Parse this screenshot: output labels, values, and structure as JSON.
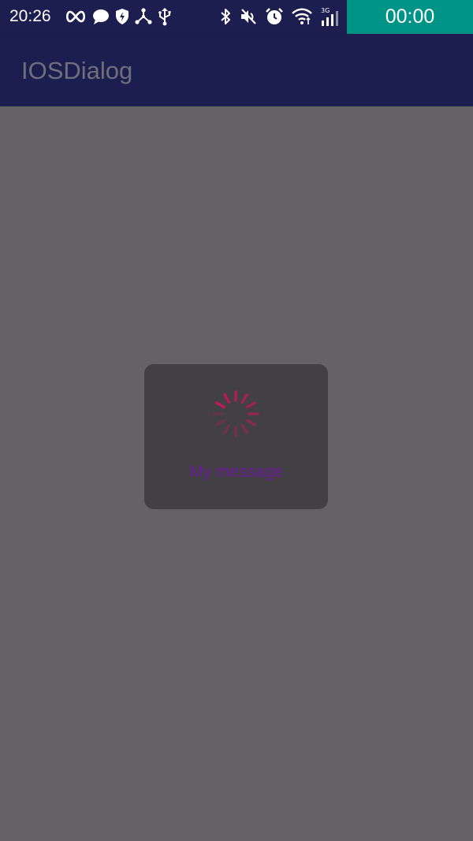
{
  "status_bar": {
    "time": "20:26",
    "icons_left": [
      "infinity-icon",
      "chat-bubble-icon",
      "shield-icon",
      "share-nodes-icon",
      "usb-icon"
    ],
    "icons_right": [
      "bluetooth-icon",
      "mute-icon",
      "alarm-icon",
      "wifi-icon",
      "signal-3g-icon"
    ],
    "timer": "00:00",
    "colors": {
      "background": "#1b1e4f",
      "timer_background": "#009387"
    }
  },
  "app_bar": {
    "title": "IOSDialog",
    "background": "#1b1e4f",
    "title_color": "#6f6f7c"
  },
  "dialog": {
    "message": "My message",
    "message_color": "#6a1b9a",
    "spinner_color": "#c2185b",
    "background": "#424043"
  },
  "screen": {
    "dim_background": "#646265"
  }
}
